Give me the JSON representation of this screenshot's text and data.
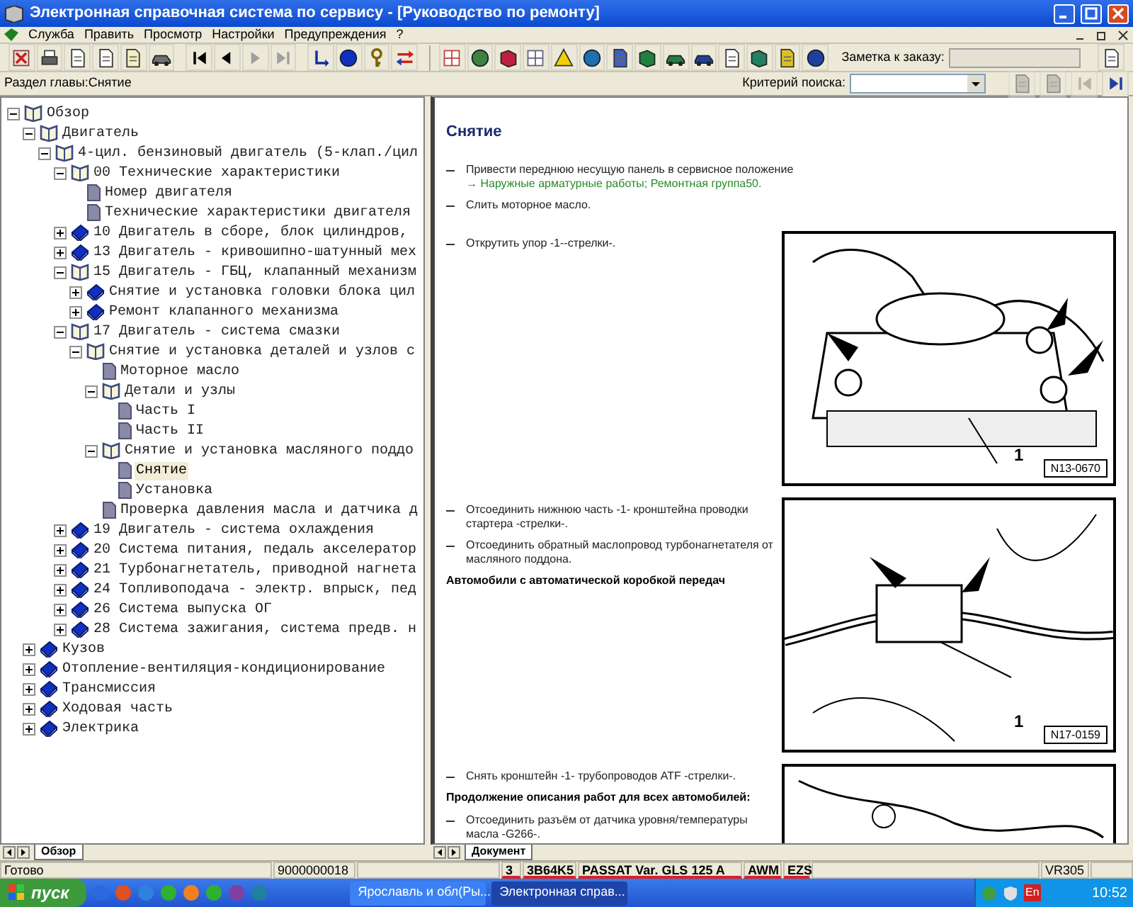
{
  "window": {
    "title": "Электронная справочная система по сервису - [Руководство по ремонту]"
  },
  "menu": [
    "Служба",
    "Править",
    "Просмотр",
    "Настройки",
    "Предупреждения",
    "?"
  ],
  "toolbar": {
    "note_label": "Заметка к заказу:"
  },
  "chapter_bar": {
    "label": "Раздел главы:Снятие",
    "search_label": "Критерий поиска:"
  },
  "tree": [
    {
      "label": "Обзор",
      "kind": "folder",
      "expanded": true,
      "selected": false,
      "children": [
        {
          "label": "Двигатель",
          "kind": "folder",
          "expanded": true,
          "selected": false,
          "children": [
            {
              "label": "4-цил. бензиновый двигатель (5-клап./цил",
              "kind": "folder",
              "expanded": true,
              "selected": false,
              "children": [
                {
                  "label": "00 Технические характеристики",
                  "kind": "folder",
                  "expanded": true,
                  "selected": false,
                  "children": [
                    {
                      "label": "Номер двигателя",
                      "kind": "page",
                      "selected": false
                    },
                    {
                      "label": "Технические характеристики двигателя",
                      "kind": "page",
                      "selected": false
                    }
                  ]
                },
                {
                  "label": "10 Двигатель в сборе, блок цилиндров,",
                  "kind": "folder",
                  "expanded": false,
                  "selected": false
                },
                {
                  "label": "13 Двигатель - кривошипно-шатунный мех",
                  "kind": "folder",
                  "expanded": false,
                  "selected": false
                },
                {
                  "label": "15 Двигатель - ГБЦ, клапанный механизм",
                  "kind": "folder",
                  "expanded": true,
                  "selected": false,
                  "children": [
                    {
                      "label": "Снятие и установка головки блока цил",
                      "kind": "folder",
                      "expanded": false,
                      "selected": false
                    },
                    {
                      "label": "Ремонт клапанного механизма",
                      "kind": "folder",
                      "expanded": false,
                      "selected": false
                    }
                  ]
                },
                {
                  "label": "17 Двигатель - система смазки",
                  "kind": "folder",
                  "expanded": true,
                  "selected": false,
                  "children": [
                    {
                      "label": "Снятие и установка деталей и узлов с",
                      "kind": "folder",
                      "expanded": true,
                      "selected": false,
                      "children": [
                        {
                          "label": "Моторное масло",
                          "kind": "page",
                          "selected": false
                        },
                        {
                          "label": "Детали и узлы",
                          "kind": "folder",
                          "expanded": true,
                          "selected": false,
                          "children": [
                            {
                              "label": "Часть I",
                              "kind": "page",
                              "selected": false
                            },
                            {
                              "label": "Часть II",
                              "kind": "page",
                              "selected": false
                            }
                          ]
                        },
                        {
                          "label": "Снятие и установка масляного поддо",
                          "kind": "folder",
                          "expanded": true,
                          "selected": false,
                          "children": [
                            {
                              "label": "Снятие",
                              "kind": "page",
                              "selected": true
                            },
                            {
                              "label": "Установка",
                              "kind": "page",
                              "selected": false
                            }
                          ]
                        },
                        {
                          "label": "Проверка давления масла и датчика д",
                          "kind": "page",
                          "selected": false
                        }
                      ]
                    }
                  ]
                },
                {
                  "label": "19 Двигатель - система охлаждения",
                  "kind": "folder",
                  "expanded": false,
                  "selected": false
                },
                {
                  "label": "20 Система питания, педаль акселератор",
                  "kind": "folder",
                  "expanded": false,
                  "selected": false
                },
                {
                  "label": "21 Турбонагнетатель, приводной нагнета",
                  "kind": "folder",
                  "expanded": false,
                  "selected": false
                },
                {
                  "label": "24 Топливоподача - электр. впрыск, пед",
                  "kind": "folder",
                  "expanded": false,
                  "selected": false
                },
                {
                  "label": "26 Система выпуска ОГ",
                  "kind": "folder",
                  "expanded": false,
                  "selected": false
                },
                {
                  "label": "28 Система зажигания, система предв. н",
                  "kind": "folder",
                  "expanded": false,
                  "selected": false
                }
              ]
            }
          ]
        },
        {
          "label": "Кузов",
          "kind": "folder",
          "expanded": false,
          "selected": false
        },
        {
          "label": "Отопление-вентиляция-кондиционирование",
          "kind": "folder",
          "expanded": false,
          "selected": false
        },
        {
          "label": "Трансмиссия",
          "kind": "folder",
          "expanded": false,
          "selected": false
        },
        {
          "label": "Ходовая часть",
          "kind": "folder",
          "expanded": false,
          "selected": false
        },
        {
          "label": "Электрика",
          "kind": "folder",
          "expanded": false,
          "selected": false
        }
      ]
    }
  ],
  "left_tab": {
    "label": "Обзор",
    "selected": true
  },
  "document": {
    "title": "Снятие",
    "sections": [
      {
        "items": [
          {
            "kind": "step",
            "text": "Привести переднюю несущую панель в сервисное положение",
            "link": "→ Наружные арматурные работы; Ремонтная группа50."
          },
          {
            "kind": "step",
            "text": "Слить моторное масло."
          }
        ]
      },
      {
        "items": [
          {
            "kind": "step",
            "text": "Открутить упор -1--стрелки-."
          }
        ],
        "figure": {
          "kind": "mount",
          "label": "N13-0670",
          "callout": "1"
        }
      },
      {
        "items": [
          {
            "kind": "step",
            "text": "Отсоединить нижнюю часть -1- кронштейна проводки стартера -стрелки-."
          },
          {
            "kind": "step",
            "text": "Отсоединить обратный маслопровод турбонагнетателя от масляного поддона."
          },
          {
            "kind": "heading",
            "text": "Автомобили с автоматической коробкой передач"
          }
        ],
        "figure": {
          "kind": "pipe",
          "label": "N17-0159",
          "callout": "1"
        }
      },
      {
        "items": [
          {
            "kind": "step",
            "text": "Снять кронштейн -1- трубопроводов ATF -стрелки-."
          },
          {
            "kind": "heading",
            "text": "Продолжение описания работ для всех автомобилей:"
          },
          {
            "kind": "step",
            "text": "Отсоединить разъём от датчика уровня/температуры масла -G266-."
          }
        ],
        "figure": {
          "kind": "partial"
        }
      }
    ]
  },
  "right_tab": {
    "label": "Документ",
    "selected": true
  },
  "status_bar": {
    "cells": [
      {
        "text": "Готово",
        "underlined": false
      },
      {
        "text": "9000000018",
        "underlined": false
      },
      {
        "text": "3",
        "underlined": true
      },
      {
        "text": "3B64K5",
        "underlined": true
      },
      {
        "text": "PASSAT Var. GLS 125 A",
        "underlined": true
      },
      {
        "text": "AWM",
        "underlined": true
      },
      {
        "text": "EZS",
        "underlined": true
      },
      {
        "text": "VR305",
        "underlined": false
      }
    ]
  },
  "taskbar": {
    "start": "пуск",
    "tasks": [
      {
        "label": "Ярославль и обл(Ры...",
        "selected": false
      },
      {
        "label": "Электронная справ...",
        "selected": true
      }
    ],
    "language": "En",
    "clock": "10:52"
  }
}
